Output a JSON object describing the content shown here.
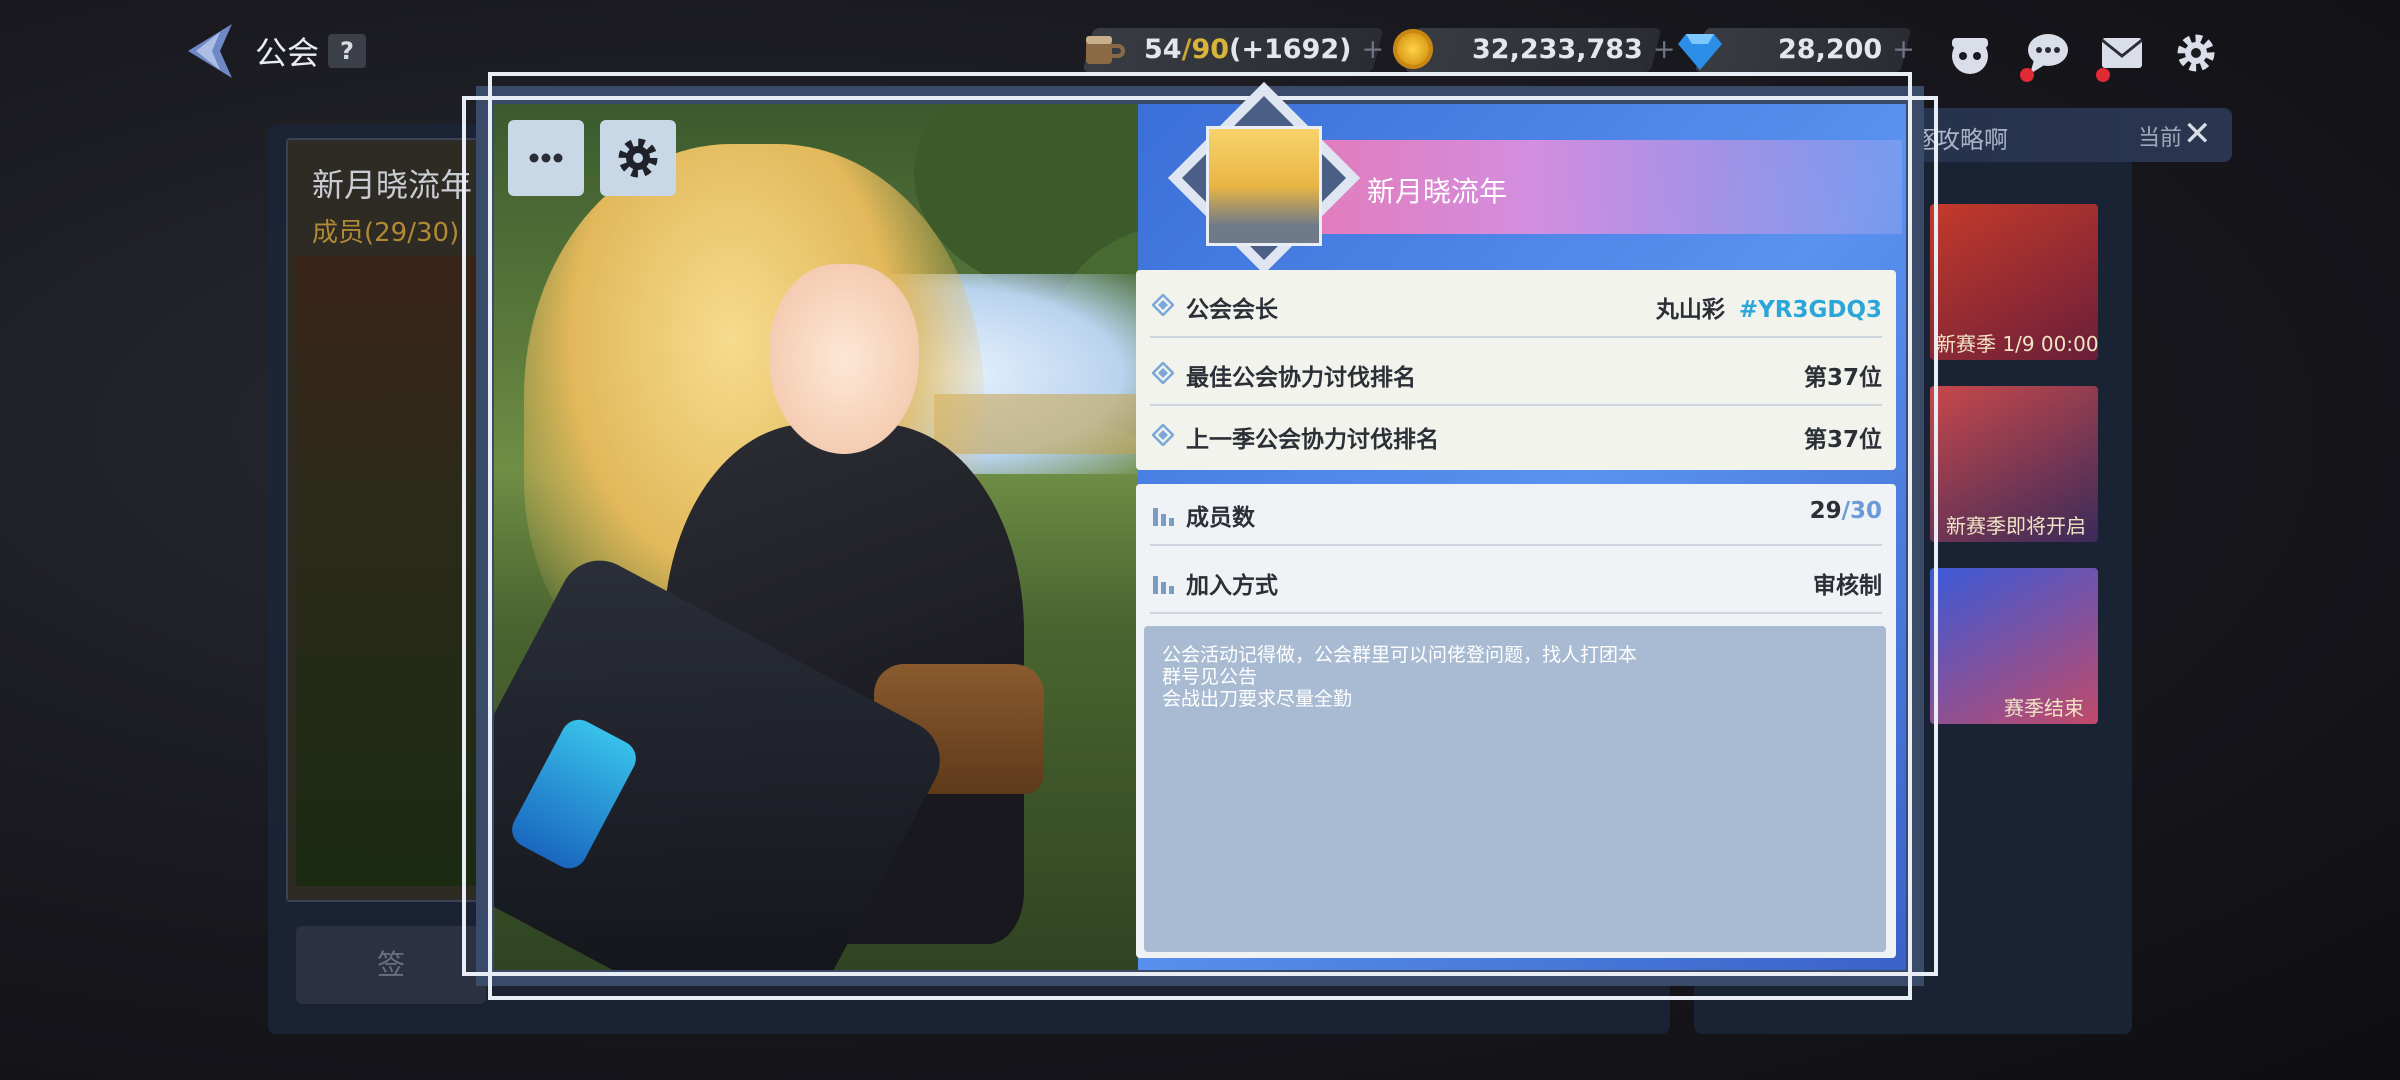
{
  "header": {
    "title": "公会",
    "help": "?",
    "stamina": {
      "current": "54",
      "max": "90",
      "bonus": "(+1692)",
      "plus": "+"
    },
    "gold": {
      "value": "32,233,783",
      "plus": "+"
    },
    "gems": {
      "value": "28,200",
      "plus": "+"
    }
  },
  "background": {
    "card_name": "新月晓流年",
    "card_members": "成员(29/30)",
    "button": "签",
    "side_header": "逐攻略啊",
    "side_current": "当前",
    "season_cards": [
      {
        "label": "新赛季 1/9 00:00"
      },
      {
        "label": "新赛季即将开启"
      },
      {
        "label": "赛季结束"
      }
    ]
  },
  "guild": {
    "name": "新月晓流年",
    "leader_label": "公会会长",
    "leader_name": "丸山彩",
    "leader_code": "#YR3GDQ3",
    "best_rank_label": "最佳公会协力讨伐排名",
    "best_rank_value": "第37位",
    "last_rank_label": "上一季公会协力讨伐排名",
    "last_rank_value": "第37位",
    "members_label": "成员数",
    "members_current": "29",
    "members_max": "/30",
    "join_label": "加入方式",
    "join_value": "审核制",
    "description": [
      "公会活动记得做，公会群里可以问佬登问题，找人打团本",
      "群号见公告",
      "会战出刀要求尽量全勤"
    ]
  },
  "icons": {
    "more": "more-icon",
    "settings": "gear-icon",
    "close": "close-icon"
  },
  "colors": {
    "accent_blue": "#2aa6d8",
    "name_band_pink": "#e47ab8",
    "description_bg": "#a8bbd2"
  }
}
